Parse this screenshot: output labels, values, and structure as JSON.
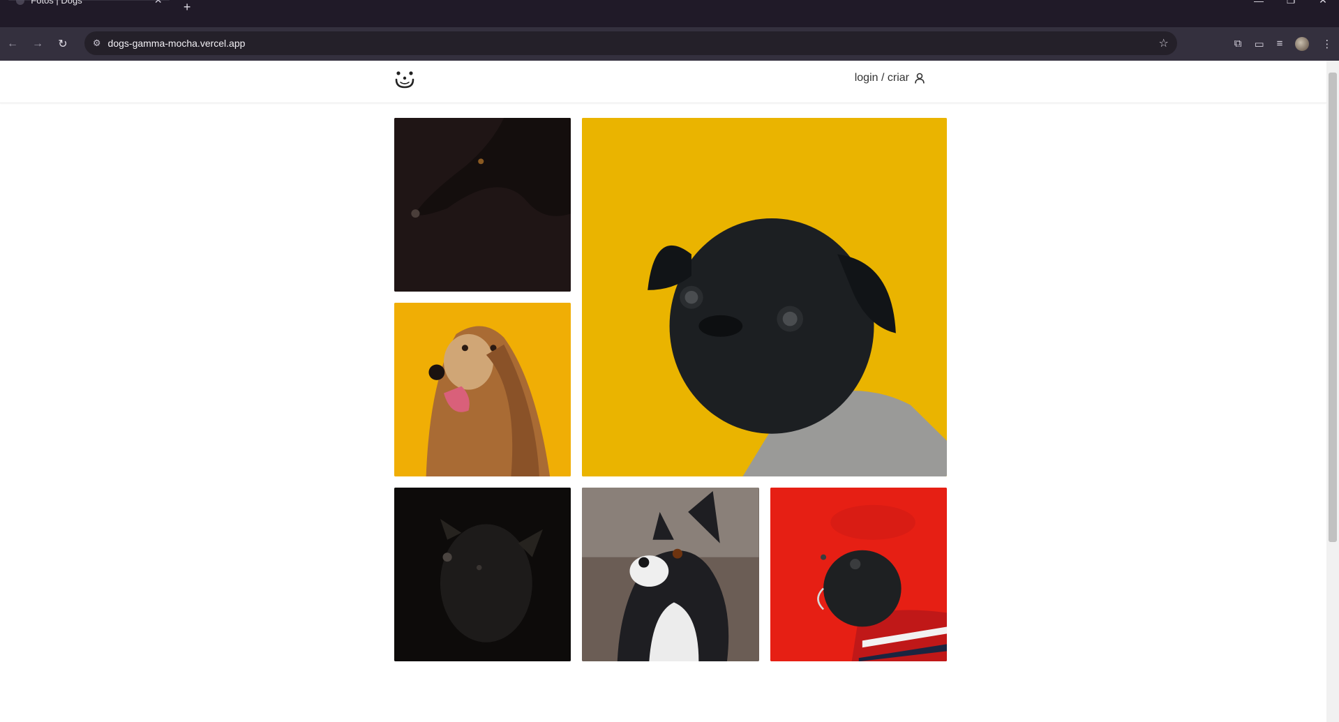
{
  "browser": {
    "tab_title": "Fotos | Dogs",
    "url": "dogs-gamma-mocha.vercel.app",
    "icons": [
      "back-icon",
      "forward-icon",
      "reload-icon",
      "site-info-icon",
      "star-icon",
      "extensions-icon",
      "cast-icon",
      "media-icon",
      "profile-avatar",
      "menu-icon"
    ]
  },
  "header": {
    "logo_icon": "dog-face-icon",
    "login_label": "login / criar",
    "user_icon": "user-icon"
  },
  "feed": {
    "photos": [
      {
        "subject": "black dog profile on dark background",
        "bg": "#1f1515"
      },
      {
        "subject": "black pug in grey knit sweater on yellow background",
        "bg": "#eab400"
      },
      {
        "subject": "long-haired afghan hound on yellow background",
        "bg": "#f0ae05"
      },
      {
        "subject": "small black dog looking up on black background",
        "bg": "#0d0b0a"
      },
      {
        "subject": "boston terrier looking up",
        "bg": "#6b5d55"
      },
      {
        "subject": "black pug in red beret and striped sweater on red background",
        "bg": "#e61f14"
      }
    ]
  },
  "colors": {
    "chrome_dark": "#201a28",
    "chrome_toolbar": "#34303e",
    "accent_yellow": "#eab400",
    "accent_red": "#e61f14"
  }
}
